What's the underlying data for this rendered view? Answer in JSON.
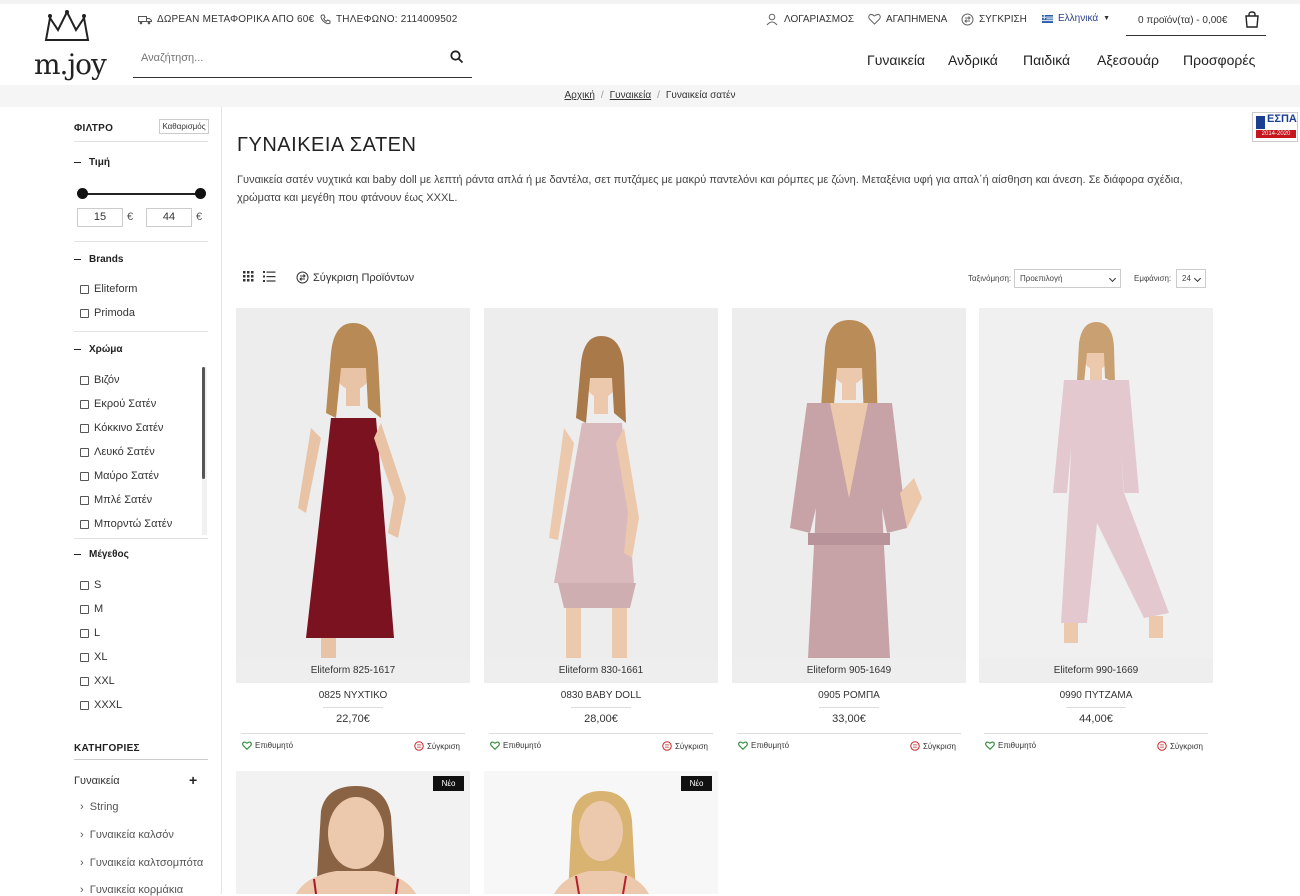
{
  "header": {
    "logo_text": "m.joy",
    "shipping_text": "ΔΩΡΕΑΝ ΜΕΤΑΦΟΡΙΚΑ ΑΠΟ 60€",
    "phone_text": "ΤΗΛΕΦΩΝΟ: 2114009502",
    "search_placeholder": "Αναζήτηση...",
    "account": "ΛΟΓΑΡΙΑΣΜΟΣ",
    "favorites": "ΑΓΑΠΗΜΕΝΑ",
    "compare": "ΣΥΓΚΡΙΣΗ",
    "language": "Ελληνικά",
    "cart": "0 προϊόν(τα) - 0,00€",
    "nav": [
      "Γυναικεία",
      "Ανδρικά",
      "Παιδικά",
      "Αξεσουάρ",
      "Προσφορές"
    ]
  },
  "breadcrumb": [
    "Αρχική",
    "Γυναικεία",
    "Γυναικεία σατέν"
  ],
  "sidebar": {
    "filter_title": "ΦΙΛΤΡΟ",
    "clear_label": "Καθαρισμός",
    "price_title": "Τιμή",
    "price_min": "15",
    "price_max": "44",
    "currency": "€",
    "brands_title": "Brands",
    "brands": [
      "Eliteform",
      "Primoda"
    ],
    "color_title": "Χρώμα",
    "colors": [
      "Βιζόν",
      "Εκρού Σατέν",
      "Κόκκινο Σατέν",
      "Λευκό Σατέν",
      "Μαύρο Σατέν",
      "Μπλέ Σατέν",
      "Μπορντώ Σατέν"
    ],
    "size_title": "Μέγεθος",
    "sizes": [
      "S",
      "M",
      "L",
      "XL",
      "XXL",
      "XXXL"
    ],
    "categories_title": "ΚΑΤΗΓΟΡΙΕΣ",
    "category": "Γυναικεία",
    "subcategories": [
      "String",
      "Γυναικεία καλσόν",
      "Γυναικεία καλτσομπότα",
      "Γυναικεία κορμάκια"
    ]
  },
  "espa": {
    "title": "ΕΣΠΑ",
    "years": "2014-2020"
  },
  "main": {
    "title": "ΓΥΝΑΙΚΕΙΑ ΣΑΤΕΝ",
    "description": "Γυναικεία σατέν νυχτικά και baby doll με λεπτή ράντα απλά ή με δαντέλα, σετ πυτζάμες με μακρύ παντελόνι και ρόμπες με ζώνη. Μεταξένια υφή για απαλ΄ή αίσθηση και άνεση. Σε διάφορα σχέδια, χρώματα και μεγέθη που φτάνουν έως XXXL.",
    "compare_products": "Σύγκριση Προϊόντων",
    "sort_label": "Ταξινόμηση:",
    "sort_value": "Προεπιλογή",
    "show_label": "Εμφάνιση:",
    "show_value": "24",
    "wishlist_label": "Επιθυμητό",
    "compare_label": "Σύγκριση",
    "new_badge": "Νέο"
  },
  "products": [
    {
      "brand": "Eliteform  825-1617",
      "name": "0825 ΝΥΧΤΙΚΟ",
      "price": "22,70€",
      "color": "#7a1220"
    },
    {
      "brand": "Eliteform  830-1661",
      "name": "0830 BABY DOLL",
      "price": "28,00€",
      "color": "#d9b9bc"
    },
    {
      "brand": "Eliteform  905-1649",
      "name": "0905 ΡΟΜΠΑ",
      "price": "33,00€",
      "color": "#c7a3a7"
    },
    {
      "brand": "Eliteform  990-1669",
      "name": "0990 ΠΥΤΖΑΜΑ",
      "price": "44,00€",
      "color": "#e3c9cf"
    }
  ]
}
